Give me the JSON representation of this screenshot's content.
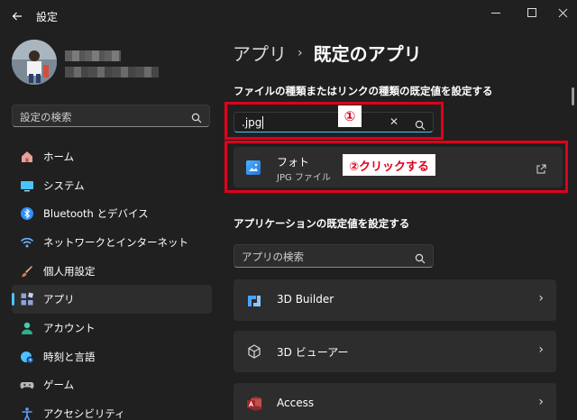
{
  "window": {
    "title": "設定",
    "back_icon": "back-arrow-icon",
    "controls": [
      "minimize-icon",
      "maximize-icon",
      "close-icon"
    ]
  },
  "sidebar": {
    "search_placeholder": "設定の検索",
    "items": [
      {
        "label": "ホーム",
        "icon": "home-icon",
        "color": "#e8a09a"
      },
      {
        "label": "システム",
        "icon": "monitor-icon",
        "color": "#4cc2ff"
      },
      {
        "label": "Bluetooth とデバイス",
        "icon": "bluetooth-icon",
        "color": "#2e8fff"
      },
      {
        "label": "ネットワークとインターネット",
        "icon": "wifi-icon",
        "color": "#6ab6ff"
      },
      {
        "label": "個人用設定",
        "icon": "brush-icon",
        "color": "#d08c6a"
      },
      {
        "label": "アプリ",
        "icon": "apps-icon",
        "color": "#8fa3d6",
        "active": true
      },
      {
        "label": "アカウント",
        "icon": "person-icon",
        "color": "#3fd2a8"
      },
      {
        "label": "時刻と言語",
        "icon": "globe-clock-icon",
        "color": "#4cc2ff"
      },
      {
        "label": "ゲーム",
        "icon": "gamepad-icon",
        "color": "#b8b8b8"
      },
      {
        "label": "アクセシビリティ",
        "icon": "accessibility-icon",
        "color": "#5aa0ff"
      }
    ]
  },
  "main": {
    "breadcrumb": {
      "parent": "アプリ",
      "separator": "›",
      "current": "既定のアプリ"
    },
    "file_type_section_title": "ファイルの種類またはリンクの種類の既定値を設定する",
    "file_search": {
      "value": ".jpg",
      "clear_icon": "close-icon"
    },
    "file_result": {
      "name": "フォト",
      "type": "JPG ファイル",
      "icon": "photos-app-icon"
    },
    "app_section_title": "アプリケーションの既定値を設定する",
    "app_search_placeholder": "アプリの検索",
    "apps": [
      {
        "name": "3D Builder",
        "icon": "3d-builder-icon"
      },
      {
        "name": "3D ビューアー",
        "icon": "3d-viewer-icon"
      },
      {
        "name": "Access",
        "icon": "access-icon"
      }
    ]
  },
  "annotations": {
    "step1": "①",
    "step2": "②クリックする",
    "color": "#e0001b"
  },
  "colors": {
    "accent": "#4cc2ff",
    "background": "#202020",
    "card": "#2d2d2d"
  }
}
